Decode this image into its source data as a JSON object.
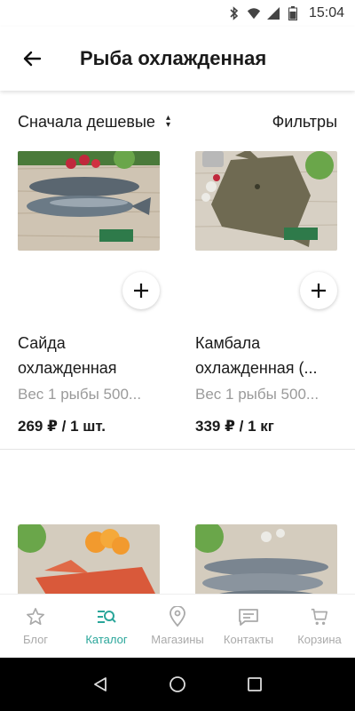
{
  "status": {
    "time": "15:04"
  },
  "header": {
    "title": "Рыба охлажденная"
  },
  "sort": {
    "label": "Сначала дешевые",
    "filters_label": "Фильтры"
  },
  "products": [
    {
      "name_line1": "Сайда",
      "name_line2": "охлажденная",
      "desc": "Вес 1 рыбы 500...",
      "price": "269 ₽ / 1 шт."
    },
    {
      "name_line1": "Камбала",
      "name_line2": "охлажденная (...",
      "desc": "Вес 1 рыбы 500...",
      "price": "339 ₽ / 1 кг"
    }
  ],
  "tabs": [
    {
      "label": "Блог",
      "icon": "star-icon"
    },
    {
      "label": "Каталог",
      "icon": "catalog-search-icon"
    },
    {
      "label": "Магазины",
      "icon": "map-pin-icon"
    },
    {
      "label": "Контакты",
      "icon": "chat-icon"
    },
    {
      "label": "Корзина",
      "icon": "cart-icon"
    }
  ],
  "colors": {
    "accent": "#2aa69a",
    "inactive": "#aaaaaa",
    "text": "#1a1a1a",
    "muted": "#9a9a9a"
  }
}
